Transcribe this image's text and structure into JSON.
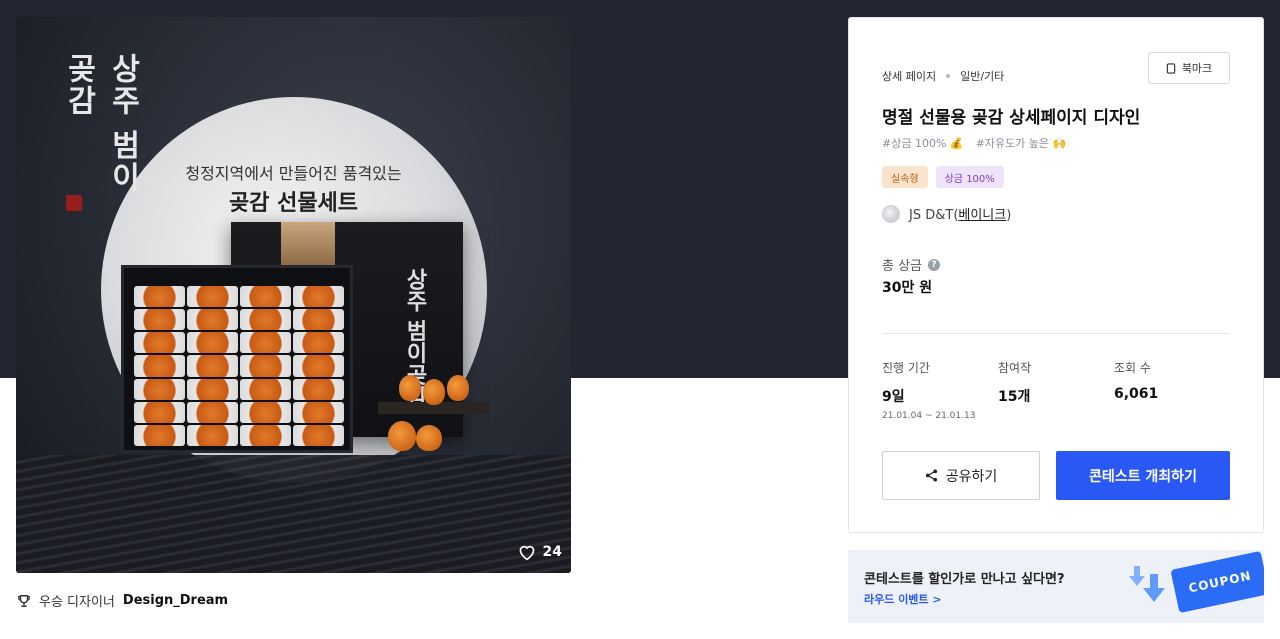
{
  "hero": {
    "brand_vertical": "상주 범이곶감",
    "headline_1": "청정지역에서 만들어진 품격있는",
    "headline_2": "곶감 선물세트",
    "box_title_vertical": "상주 범이곶감",
    "like_count": "24"
  },
  "winner": {
    "prefix": "우승 디자이너",
    "name": "Design_Dream"
  },
  "card": {
    "breadcrumb": [
      "상세 페이지",
      "일반/기타"
    ],
    "bookmark_label": "북마크",
    "title": "명절 선물용 곶감 상세페이지 디자인",
    "hashtags": [
      {
        "text": "#상금 100%",
        "emoji": "💰"
      },
      {
        "text": "#자유도가 높은",
        "emoji": "🙌"
      }
    ],
    "badges": [
      "실속형",
      "상금 100%"
    ],
    "host": {
      "name": "JS D&T",
      "handle": "베이니크"
    },
    "prize_label": "총 상금",
    "prize_value": "30만 원",
    "stats": {
      "period_label": "진행 기간",
      "period_value": "9일",
      "period_range": "21.01.04 ~ 21.01.13",
      "entries_label": "참여작",
      "entries_value": "15개",
      "views_label": "조회 수",
      "views_value": "6,061"
    },
    "share_label": "공유하기",
    "host_contest_label": "콘테스트 개최하기"
  },
  "promo": {
    "text": "콘테스트를 할인가로 만나고 싶다면?",
    "link": "라우드 이벤트 >",
    "coupon": "COUPON"
  },
  "colors": {
    "header_bg": "#232632",
    "primary": "#2a58f5",
    "badge_orange_bg": "#fbe3cc",
    "badge_purple_bg": "#efe3fb"
  }
}
